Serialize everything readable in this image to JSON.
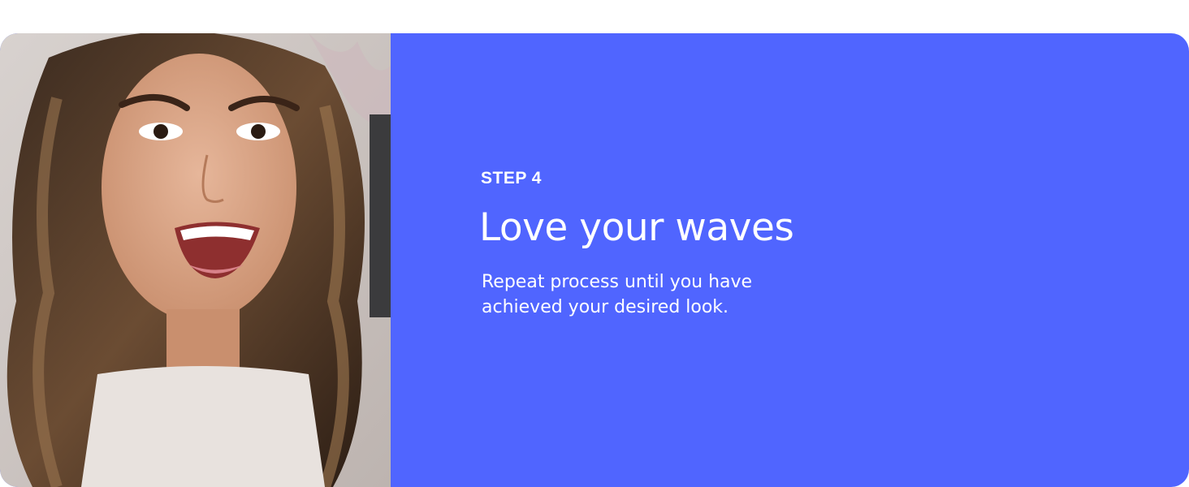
{
  "step": {
    "label": "STEP 4",
    "title": "Love your waves",
    "description": "Repeat process until you have achieved your desired look."
  },
  "colors": {
    "panel_background": "#5065FF",
    "page_background": "#FFFFFF",
    "text": "#FFFFFF"
  }
}
